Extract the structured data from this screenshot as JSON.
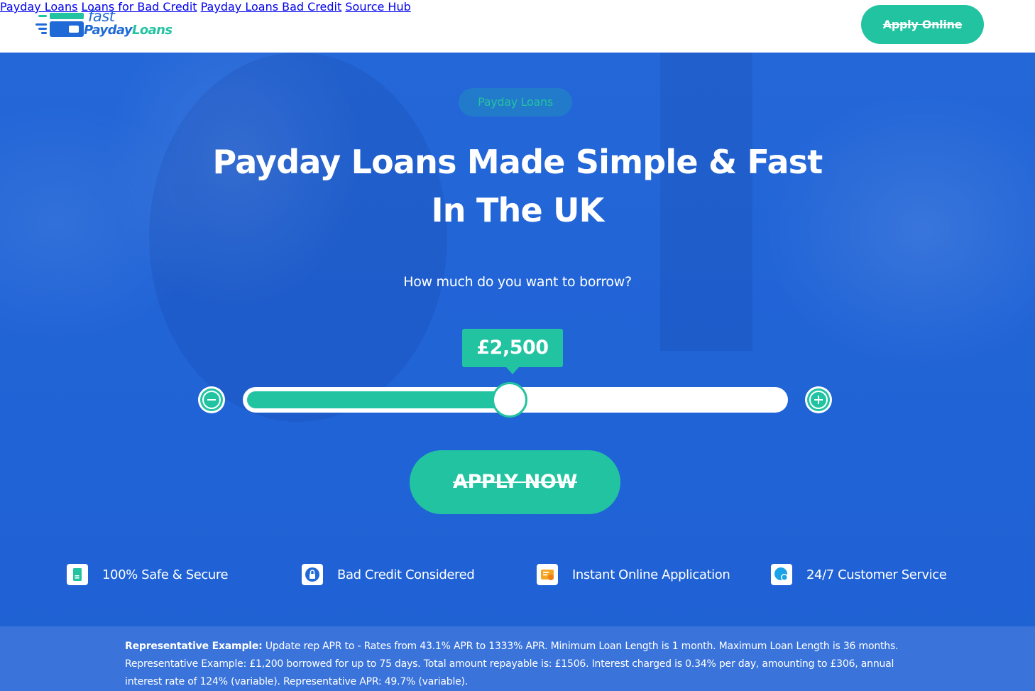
{
  "brand": {
    "logo_line1": "fast",
    "logo_line2_part1": "Payday",
    "logo_line2_part2": "Loans",
    "colors": {
      "primary": "#1f6ad6",
      "accent": "#22c3a1",
      "hero_bg": "#2166d9",
      "nav_text": "#3a4254"
    }
  },
  "nav": {
    "items": [
      {
        "label": "Payday Loans"
      },
      {
        "label": "Loans for Bad Credit"
      },
      {
        "label": "Payday Loans Bad Credit"
      },
      {
        "label": "Source Hub"
      }
    ],
    "cta_label": "Apply Online"
  },
  "hero": {
    "tag": "Payday Loans",
    "title_line1": "Payday Loans Made Simple & Fast",
    "title_line2": "In The UK",
    "question": "How much do you want to borrow?",
    "amount_display": "£2,500",
    "slider_fraction": 0.49,
    "minus_icon": "minus-circle-icon",
    "plus_icon": "plus-circle-icon",
    "apply_label": "APPLY NOW"
  },
  "features": [
    {
      "icon": "document-icon",
      "label": "100% Safe & Secure"
    },
    {
      "icon": "lock-icon",
      "label": "Bad Credit Considered"
    },
    {
      "icon": "application-form-icon",
      "label": "Instant Online Application"
    },
    {
      "icon": "chat-support-icon",
      "label": "24/7 Customer Service"
    }
  ],
  "representative": {
    "heading": "Representative Example:",
    "text": " Update rep APR to - Rates from 43.1% APR to 1333% APR. Minimum Loan Length is 1 month. Maximum Loan Length is 36 months. Representative Example: £1,200 borrowed for up to 75 days. Total amount repayable is: £1506. Interest charged is 0.34% per day, amounting to £306, annual interest rate of 124% (variable). Representative APR: 49.7% (variable)."
  }
}
